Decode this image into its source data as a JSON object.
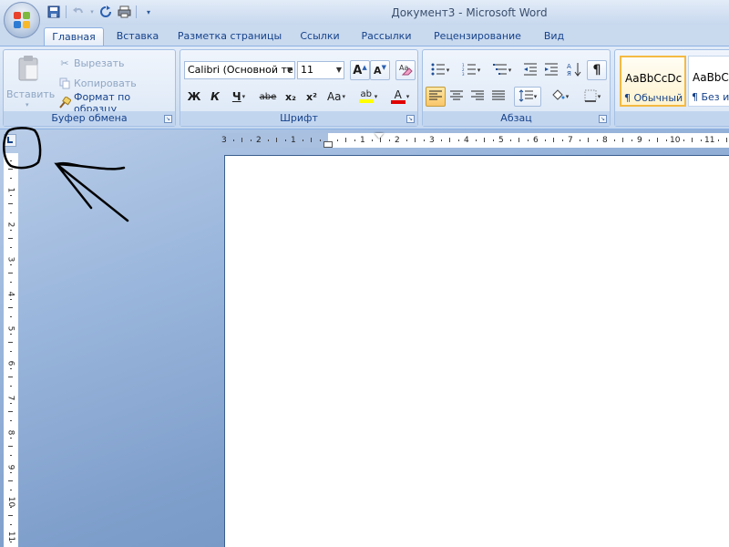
{
  "window": {
    "title": "Документ3 - Microsoft Word"
  },
  "office_button": {
    "icon": "office-logo-icon"
  },
  "quick_access": [
    {
      "name": "save-icon"
    },
    {
      "name": "undo-icon"
    },
    {
      "name": "undo-dropdown-icon"
    },
    {
      "name": "redo-icon"
    },
    {
      "name": "print-icon"
    },
    {
      "name": "customize-qat-icon"
    }
  ],
  "tabs": [
    {
      "label": "Главная",
      "active": true
    },
    {
      "label": "Вставка"
    },
    {
      "label": "Разметка страницы"
    },
    {
      "label": "Ссылки"
    },
    {
      "label": "Рассылки"
    },
    {
      "label": "Рецензирование"
    },
    {
      "label": "Вид"
    }
  ],
  "clipboard": {
    "label": "Буфер обмена",
    "paste": "Вставить",
    "cut": "Вырезать",
    "copy": "Копировать",
    "format_painter": "Формат по образцу"
  },
  "font": {
    "label": "Шрифт",
    "family": "Calibri (Основной те",
    "size": "11",
    "bold": "Ж",
    "italic": "К",
    "underline": "Ч",
    "strike": "abe",
    "subscript": "x₂",
    "superscript": "x²",
    "change_case": "Aa",
    "grow": "A",
    "shrink": "A",
    "highlight": "ab",
    "color": "A",
    "highlight_color": "#ffff00",
    "font_color": "#e00000"
  },
  "paragraph": {
    "label": "Абзац",
    "show_marks": "¶"
  },
  "styles": [
    {
      "sample": "AaBbCcDc",
      "name": "¶ Обычный",
      "selected": true
    },
    {
      "sample": "AaBbCc",
      "name": "¶ Без инт"
    }
  ],
  "ruler": {
    "horizontal_left": [
      "3",
      "2",
      "1"
    ],
    "horizontal_right": [
      "1",
      "2",
      "3",
      "4",
      "5",
      "6",
      "7",
      "8",
      "9",
      "10",
      "11"
    ],
    "vertical": [
      "1",
      "2",
      "3",
      "4",
      "5",
      "6",
      "7",
      "8",
      "9",
      "10",
      "11"
    ]
  },
  "colors": {
    "accent": "#15428b",
    "ribbon": "#dbe7f6",
    "workspace": "#7d9dca"
  }
}
